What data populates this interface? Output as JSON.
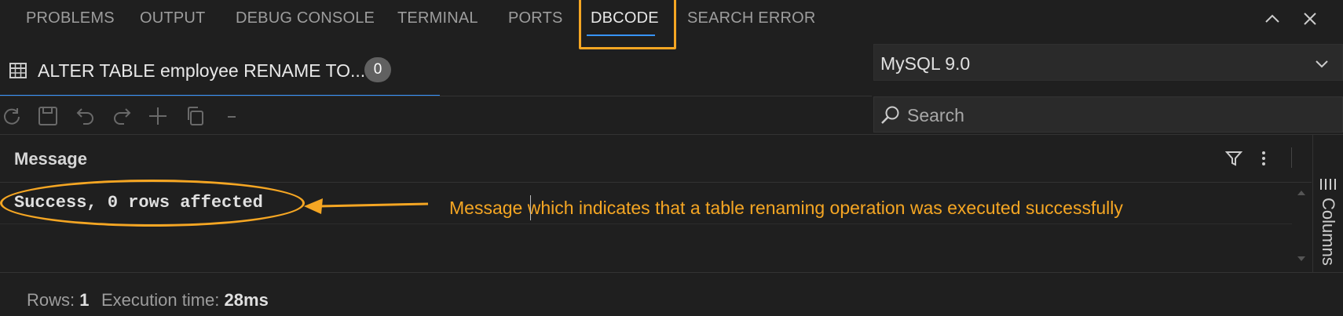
{
  "panel_tabs": [
    {
      "label": "PROBLEMS"
    },
    {
      "label": "OUTPUT"
    },
    {
      "label": "DEBUG CONSOLE"
    },
    {
      "label": "TERMINAL"
    },
    {
      "label": "PORTS"
    },
    {
      "label": "DBCODE",
      "active": true
    },
    {
      "label": "SEARCH ERROR"
    }
  ],
  "query_tab": {
    "title": "ALTER TABLE employee RENAME TO...",
    "badge": "0"
  },
  "db_select": {
    "value": "MySQL 9.0"
  },
  "search": {
    "placeholder": "Search"
  },
  "grid": {
    "column": "Message",
    "rows": [
      {
        "message": "Success, 0 rows affected"
      }
    ]
  },
  "side_panel": {
    "label": "Columns"
  },
  "annotation": {
    "text": "Message which indicates that a table renaming operation was executed successfully",
    "color": "#f5a623"
  },
  "status": {
    "rows_label": "Rows:",
    "rows_value": "1",
    "time_label": "Execution time:",
    "time_value": "28ms"
  },
  "icons": [
    "grid-icon",
    "refresh-icon",
    "save-icon",
    "undo-icon",
    "redo-icon",
    "add-icon",
    "copy-icon",
    "remove-icon",
    "search-icon",
    "chevron-down-icon",
    "chevron-up-icon",
    "close-icon",
    "filter-icon",
    "more-icon",
    "columns-icon"
  ],
  "colors": {
    "accent": "#3794ff",
    "highlight": "#f5a623",
    "background": "#1f1f1f"
  }
}
